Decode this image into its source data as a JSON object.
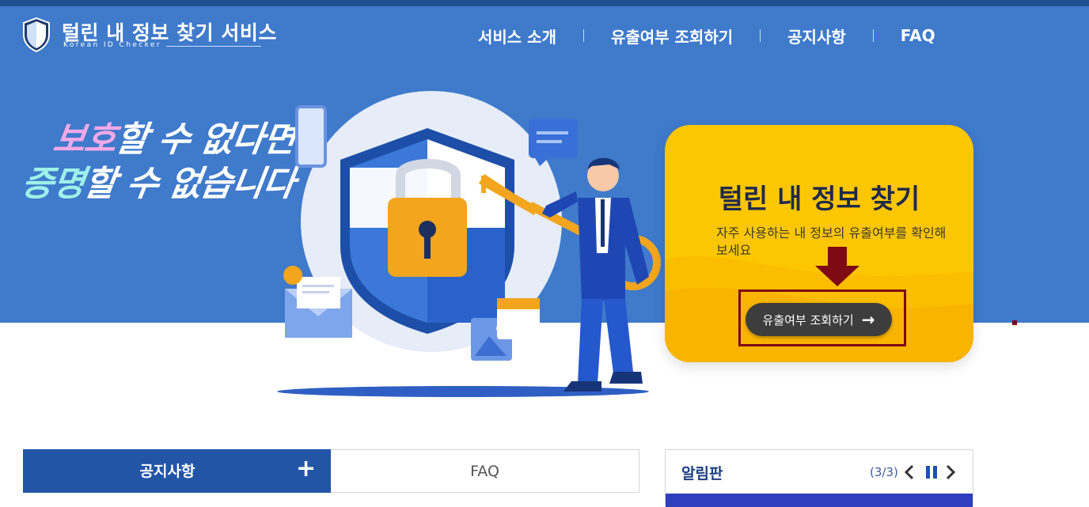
{
  "header": {
    "logo_title": "털린 내 정보 찾기 서비스",
    "logo_subtitle": "Korean ID Checker",
    "nav": [
      "서비스 소개",
      "유출여부 조회하기",
      "공지사항",
      "FAQ"
    ]
  },
  "hero": {
    "slogan_line1_highlight": "보호",
    "slogan_line1_rest": "할 수 없다면",
    "slogan_line2_highlight": "증명",
    "slogan_line2_rest": "할 수 없습니다"
  },
  "promo": {
    "title": "털린 내 정보 찾기",
    "description": "자주 사용하는 내 정보의 유출여부를 확인해보세요",
    "cta_label": "유출여부 조회하기",
    "cta_icon": "arrow-right-icon"
  },
  "tabs": {
    "notice_label": "공지사항",
    "notice_more_icon": "+",
    "faq_label": "FAQ"
  },
  "board": {
    "title": "알림판",
    "counter": "(3/3)",
    "prev_icon": "chevron-left-icon",
    "pause_icon": "pause-icon",
    "next_icon": "chevron-right-icon"
  },
  "colors": {
    "hero_blue": "#3f7acb",
    "promo_yellow": "#fcc600",
    "tab_active": "#2355a6",
    "highlight_box": "#7d0a14"
  }
}
